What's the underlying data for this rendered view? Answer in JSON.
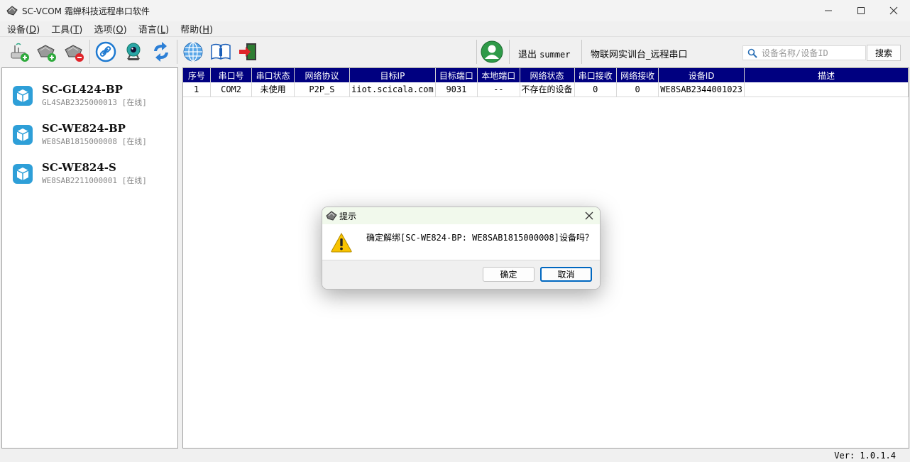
{
  "window": {
    "title": "SC-VCOM 霜蝉科技远程串口软件"
  },
  "menu": [
    {
      "label": "设备",
      "key": "D"
    },
    {
      "label": "工具",
      "key": "T"
    },
    {
      "label": "选项",
      "key": "O"
    },
    {
      "label": "语言",
      "key": "L"
    },
    {
      "label": "帮助",
      "key": "H"
    }
  ],
  "toolbar": {
    "logout": "退出",
    "username": "summer",
    "platform": "物联网实训台_远程串口",
    "search_placeholder": "设备名称/设备ID",
    "search_button": "搜索"
  },
  "devices": [
    {
      "name": "SC-GL424-BP",
      "id": "GL4SAB2325000013",
      "status": "[在线]"
    },
    {
      "name": "SC-WE824-BP",
      "id": "WE8SAB1815000008",
      "status": "[在线]"
    },
    {
      "name": "SC-WE824-S",
      "id": "WE8SAB2211000001",
      "status": "[在线]"
    }
  ],
  "table": {
    "columns": [
      "序号",
      "串口号",
      "串口状态",
      "网络协议",
      "目标IP",
      "目标端口",
      "本地端口",
      "网络状态",
      "串口接收",
      "网络接收",
      "设备ID",
      "描述"
    ],
    "rows": [
      [
        "1",
        "COM2",
        "未使用",
        "P2P_S",
        "iiot.scicala.com",
        "9031",
        "--",
        "不存在的设备",
        "0",
        "0",
        "WE8SAB2344001023",
        ""
      ]
    ]
  },
  "status": {
    "version": "Ver: 1.0.1.4"
  },
  "dialog": {
    "title": "提示",
    "message": "确定解绑[SC-WE824-BP: WE8SAB1815000008]设备吗？",
    "ok": "确定",
    "cancel": "取消"
  },
  "colors": {
    "table_header": "#000080",
    "accent": "#0067c0"
  }
}
